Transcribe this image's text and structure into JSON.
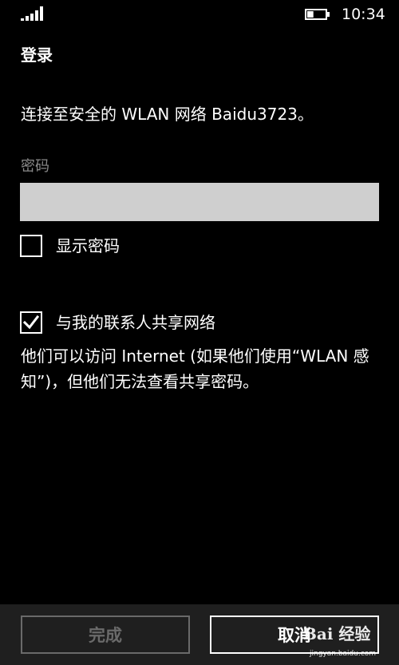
{
  "status_bar": {
    "time": "10:34",
    "signal_icon": "signal-strength-icon",
    "battery_icon": "battery-icon",
    "battery_level": 0.35
  },
  "page": {
    "title": "登录",
    "message": "连接至安全的 WLAN 网络 Baidu3723。"
  },
  "password": {
    "label": "密码",
    "value": ""
  },
  "show_password": {
    "label": "显示密码",
    "checked": false
  },
  "share_network": {
    "label": "与我的联系人共享网络",
    "checked": true,
    "description": "他们可以访问 Internet (如果他们使用“WLAN 感知”)，但他们无法查看共享密码。"
  },
  "app_bar": {
    "done_label": "完成",
    "done_enabled": false,
    "cancel_label": "取消"
  },
  "watermark": {
    "logo": "Bai 经验",
    "url": "jingyan.baidu.com"
  },
  "colors": {
    "background": "#000000",
    "text": "#ffffff",
    "input_background": "#cfcfcf",
    "field_label": "#8a8a8a",
    "app_bar": "#1f1f1f",
    "disabled": "#6a6a6a"
  }
}
